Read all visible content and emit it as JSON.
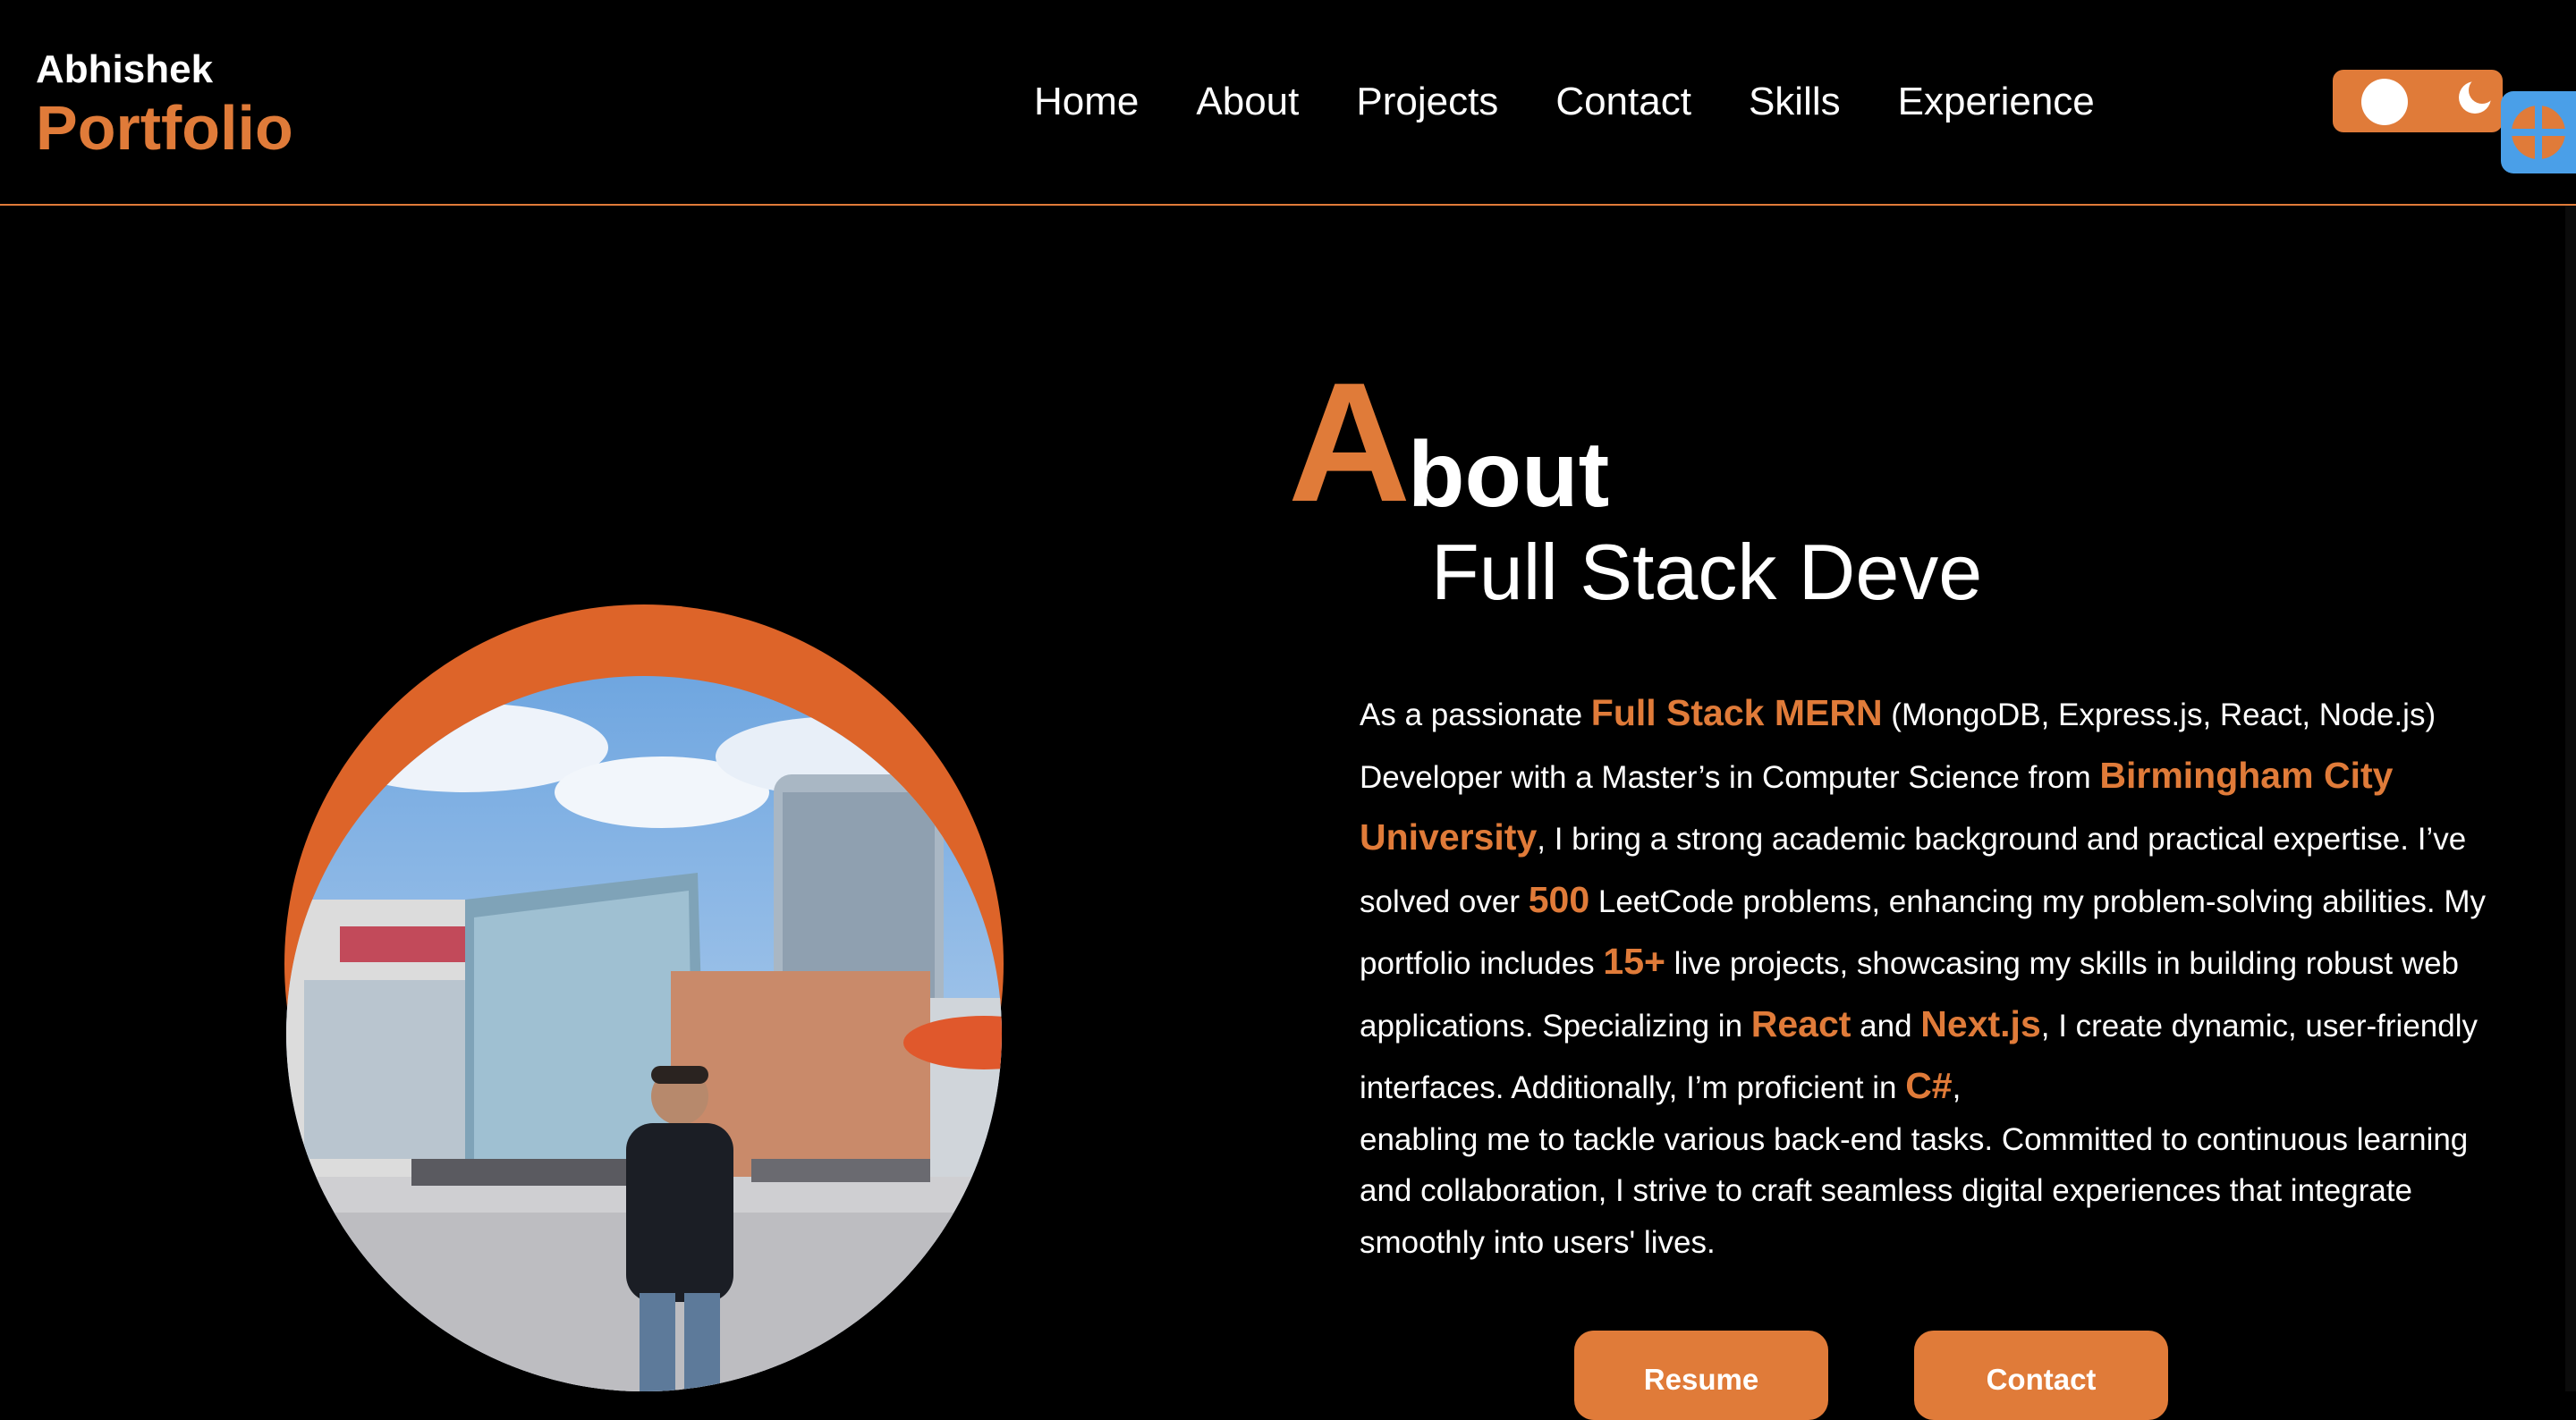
{
  "brand": {
    "first": "Abhishek",
    "second": "Portfolio"
  },
  "nav": {
    "items": [
      "Home",
      "About",
      "Projects",
      "Contact",
      "Skills",
      "Experience"
    ]
  },
  "theme_toggle": {
    "icon": "moon-icon"
  },
  "about": {
    "title_initial": "A",
    "title_rest": "bout",
    "subtitle": "Full Stack Deve",
    "paragraph": {
      "t1": "As a passionate ",
      "h1": "Full Stack MERN",
      "t2": " (MongoDB, Express.js, React, Node.js) Developer with a Master’s in Computer Science from ",
      "h2": "Birmingham City University",
      "t3": ", I bring a strong academic background and practical expertise. I’ve solved over ",
      "h3": "500",
      "t4": " LeetCode problems, enhancing my problem-solving abilities. My portfolio includes ",
      "h4": "15+",
      "t5": " live projects, showcasing my skills in building robust web applications. Specializing in ",
      "h5": "React",
      "t6": " and ",
      "h6": "Next.js",
      "t7": ", I create dynamic, user-friendly interfaces. Additionally, I’m proficient in ",
      "h7": "C#",
      "t8": ",",
      "t9": "enabling me to tackle various back-end tasks. Committed to continuous learning and collaboration, I strive to craft seamless digital experiences that integrate smoothly into users' lives."
    },
    "buttons": {
      "resume": "Resume",
      "contact": "Contact"
    }
  },
  "colors": {
    "accent": "#e07b39",
    "background": "#000000",
    "text": "#ffffff",
    "photo_arc": "#dd6429",
    "widget": "#4a9fe8"
  }
}
